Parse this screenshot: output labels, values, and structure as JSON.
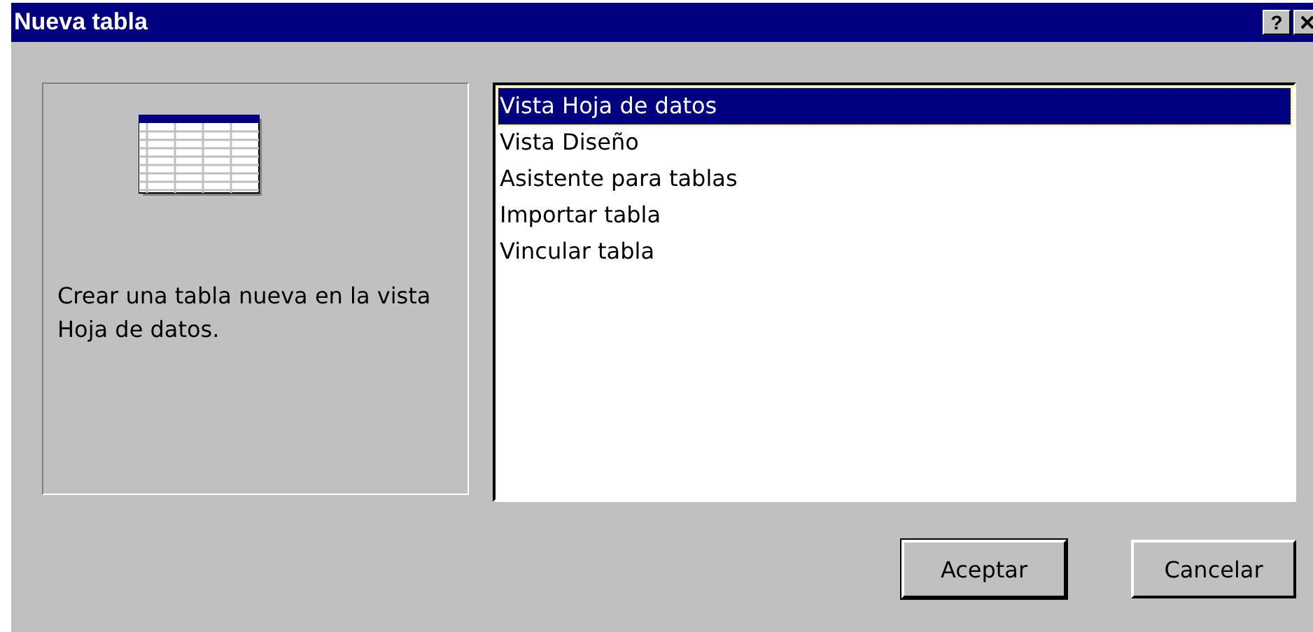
{
  "window": {
    "title": "Nueva tabla",
    "help_button": "?"
  },
  "description": "Crear una tabla nueva en la vista Hoja de datos.",
  "options": [
    {
      "label": "Vista Hoja de datos",
      "selected": true
    },
    {
      "label": "Vista Diseño",
      "selected": false
    },
    {
      "label": "Asistente para tablas",
      "selected": false
    },
    {
      "label": "Importar tabla",
      "selected": false
    },
    {
      "label": "Vincular tabla",
      "selected": false
    }
  ],
  "buttons": [
    "Aceptar",
    "Cancelar"
  ]
}
